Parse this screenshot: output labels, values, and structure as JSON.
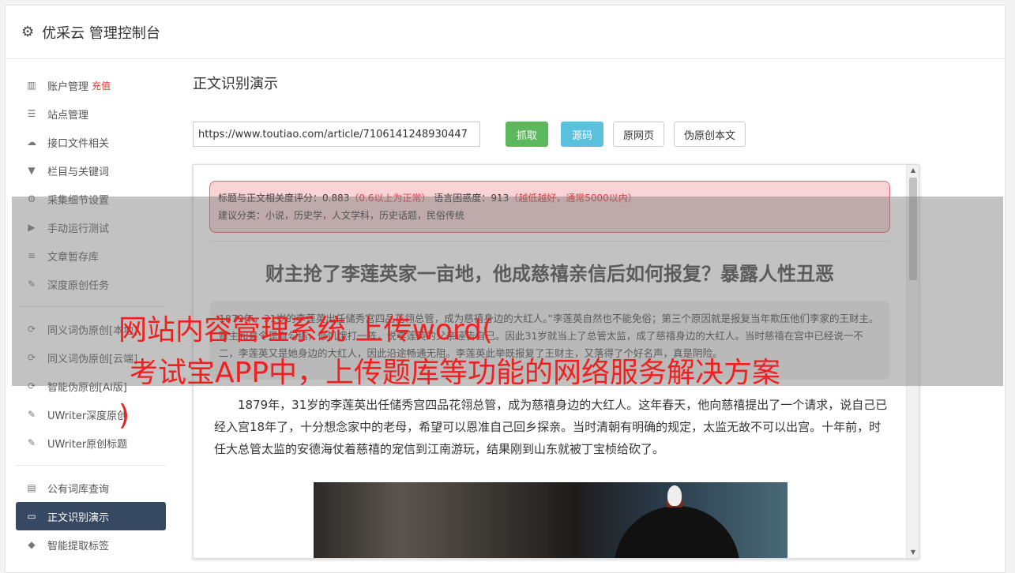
{
  "app": {
    "title": "优采云 管理控制台"
  },
  "sidebar": {
    "groups": [
      [
        {
          "name": "sidebar-item-account",
          "icon": "bar-chart-icon",
          "glyph": "▥",
          "label": "账户管理",
          "badge": "充值"
        },
        {
          "name": "sidebar-item-sites",
          "icon": "server-icon",
          "glyph": "☰",
          "label": "站点管理"
        },
        {
          "name": "sidebar-item-api-files",
          "icon": "cloud-upload-icon",
          "glyph": "☁",
          "label": "接口文件相关"
        },
        {
          "name": "sidebar-item-columns-keywords",
          "icon": "filter-icon",
          "glyph": "▼",
          "label": "栏目与关键词"
        },
        {
          "name": "sidebar-item-collect-settings",
          "icon": "gears-icon",
          "glyph": "⚙",
          "label": "采集细节设置"
        },
        {
          "name": "sidebar-item-manual-run",
          "icon": "play-icon",
          "glyph": "▶",
          "label": "手动运行测试"
        },
        {
          "name": "sidebar-item-article-store",
          "icon": "database-icon",
          "glyph": "≡",
          "label": "文章暂存库"
        },
        {
          "name": "sidebar-item-deep-original",
          "icon": "edit-icon",
          "glyph": "✎",
          "label": "深度原创任务"
        }
      ],
      [
        {
          "name": "sidebar-item-synonym-1",
          "icon": "refresh-icon",
          "glyph": "⟳",
          "label": "同义词伪原创[本地]"
        },
        {
          "name": "sidebar-item-synonym-2",
          "icon": "refresh-icon",
          "glyph": "⟳",
          "label": "同义词伪原创[云端]"
        },
        {
          "name": "sidebar-item-ai-original",
          "icon": "refresh-icon",
          "glyph": "⟳",
          "label": "智能伪原创[AI版]"
        },
        {
          "name": "sidebar-item-uwriter-deep",
          "icon": "edit-icon",
          "glyph": "✎",
          "label": "UWriter深度原创"
        },
        {
          "name": "sidebar-item-uwriter-title",
          "icon": "edit-icon",
          "glyph": "✎",
          "label": "UWriter原创标题"
        }
      ],
      [
        {
          "name": "sidebar-item-public-lexicon",
          "icon": "book-icon",
          "glyph": "▤",
          "label": "公有词库查询"
        },
        {
          "name": "sidebar-item-text-recognition",
          "icon": "desktop-icon",
          "glyph": "▭",
          "label": "正文识别演示",
          "active": true
        },
        {
          "name": "sidebar-item-smart-tags",
          "icon": "tag-icon",
          "glyph": "◆",
          "label": "智能提取标签"
        }
      ]
    ]
  },
  "main": {
    "title": "正文识别演示",
    "url_value": "https://www.toutiao.com/article/7106141248930447",
    "buttons": {
      "fetch": "抓取",
      "source": "源码",
      "original_page": "原网页",
      "pseudo_original": "伪原创本文"
    }
  },
  "result": {
    "score_label": "标题与正文相关度评分：",
    "score_value": "0.883",
    "score_note": "（0.6以上为正常）",
    "perplexity_label": "语言困惑度：",
    "perplexity_value": "913",
    "perplexity_note": "（越低越好，通常5000以内）",
    "category": "建议分类：小说，历史学，人文学科，历史话题，民俗传统",
    "article_title": "财主抢了李莲英家一亩地，他成慈禧亲信后如何报复？暴露人性丑恶",
    "summary": "1879年，31岁的李莲英出任储秀宫四品花翎总管，成为慈禧身边的大红人。”李莲英自然也不能免俗；第三个原因就是报复当年欺压他们李家的王财主。财主和县令是有勾结，修饥饿打一阵，说李莲英的父亲诬告自己。因此31岁就当上了总管太监，成了慈禧身边的大红人。当时慈禧在宫中已经说一不二，李莲英又是她身边的大红人，因此沿途畅通无阻。李莲英此举既报复了王财主，又落得了个好名声，真是阴险。",
    "paragraph": "1879年，31岁的李莲英出任储秀宫四品花翎总管，成为慈禧身边的大红人。这年春天，他向慈禧提出了一个请求，说自己已经入宫18年了，十分想念家中的老母，希望可以恩准自己回乡探亲。当时清朝有明确的规定，太监无故不可以出宫。十年前，时任大总管太监的安德海仗着慈禧的宠信到江南游玩，结果刚到山东就被丁宝桢给砍了。"
  },
  "overlay": {
    "line1": "网站内容管理系统 上传word(",
    "line2": "考试宝APP中，上传题库等功能的网络服务解决方案",
    "line3": ")"
  },
  "colors": {
    "active_nav": "#364862",
    "fetch_button": "#5cb85c",
    "source_button": "#5bc0de",
    "score_box_bg": "#f9d3d6",
    "overlay_text": "#ef2020"
  }
}
